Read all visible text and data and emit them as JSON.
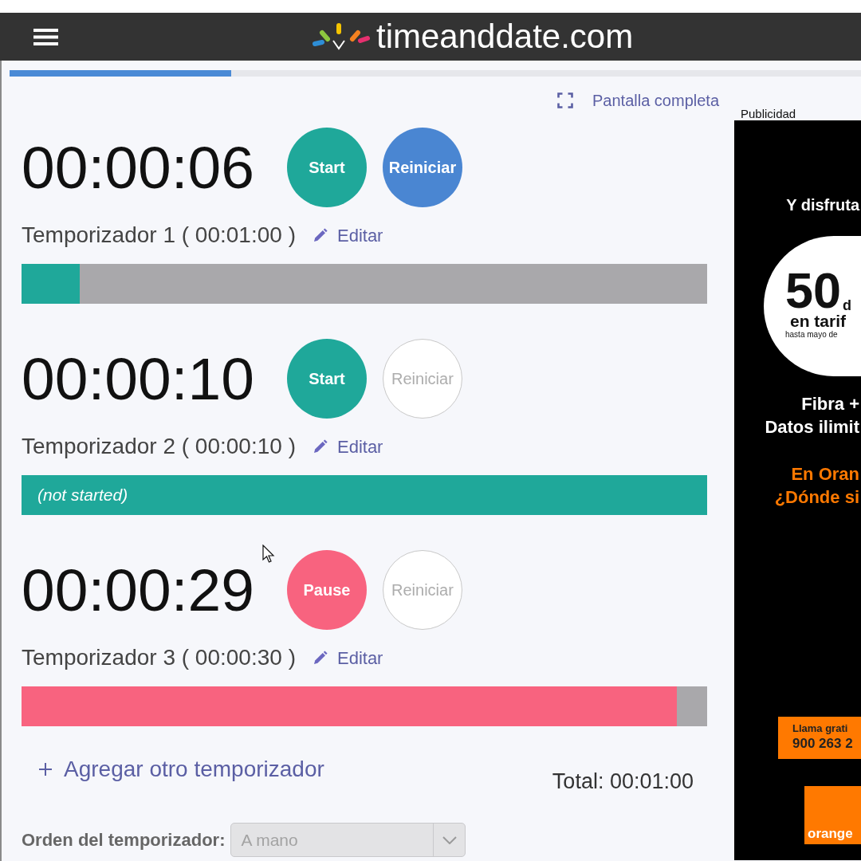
{
  "header": {
    "logo_text": "timeanddate.com"
  },
  "page_progress": {
    "level": 0.26
  },
  "fullscreen_link": {
    "label": "Pantalla completa"
  },
  "timers": [
    {
      "time": "00:00:06",
      "primary_button": {
        "label": "Start",
        "kind": "start"
      },
      "reset_button": {
        "label": "Reiniciar",
        "disabled": false
      },
      "title": "Temporizador 1 ( 00:01:00 )",
      "edit_label": "Editar",
      "running": false,
      "bar": {
        "level": 0.085
      }
    },
    {
      "time": "00:00:10",
      "primary_button": {
        "label": "Start",
        "kind": "start"
      },
      "reset_button": {
        "label": "Reiniciar",
        "disabled": true
      },
      "title": "Temporizador 2 ( 00:00:10 )",
      "edit_label": "Editar",
      "running": false,
      "bar": {
        "level": 1,
        "label": "(not started)"
      }
    },
    {
      "time": "00:00:29",
      "primary_button": {
        "label": "Pause",
        "kind": "pause"
      },
      "reset_button": {
        "label": "Reiniciar",
        "disabled": true
      },
      "title": "Temporizador 3 ( 00:00:30 )",
      "edit_label": "Editar",
      "running": true,
      "bar": {
        "level": 0.956
      }
    }
  ],
  "add_timer": {
    "label": "Agregar otro temporizador"
  },
  "total": "Total: 00:01:00",
  "order": {
    "label": "Orden del temporizador:",
    "value": "A mano",
    "disabled": true
  },
  "ad": {
    "label": "Publicidad",
    "headline": "Y disfruta",
    "circle": {
      "big": "50",
      "suffix": "d",
      "line": "en tarif",
      "note": "hasta mayo de"
    },
    "white_lines": [
      "Fibra +",
      "Datos ilimit"
    ],
    "orange_lines": [
      "En Oran",
      "¿Dónde si"
    ],
    "call_box": [
      "Llama grati",
      "900 263 2"
    ],
    "logo": "orange"
  }
}
